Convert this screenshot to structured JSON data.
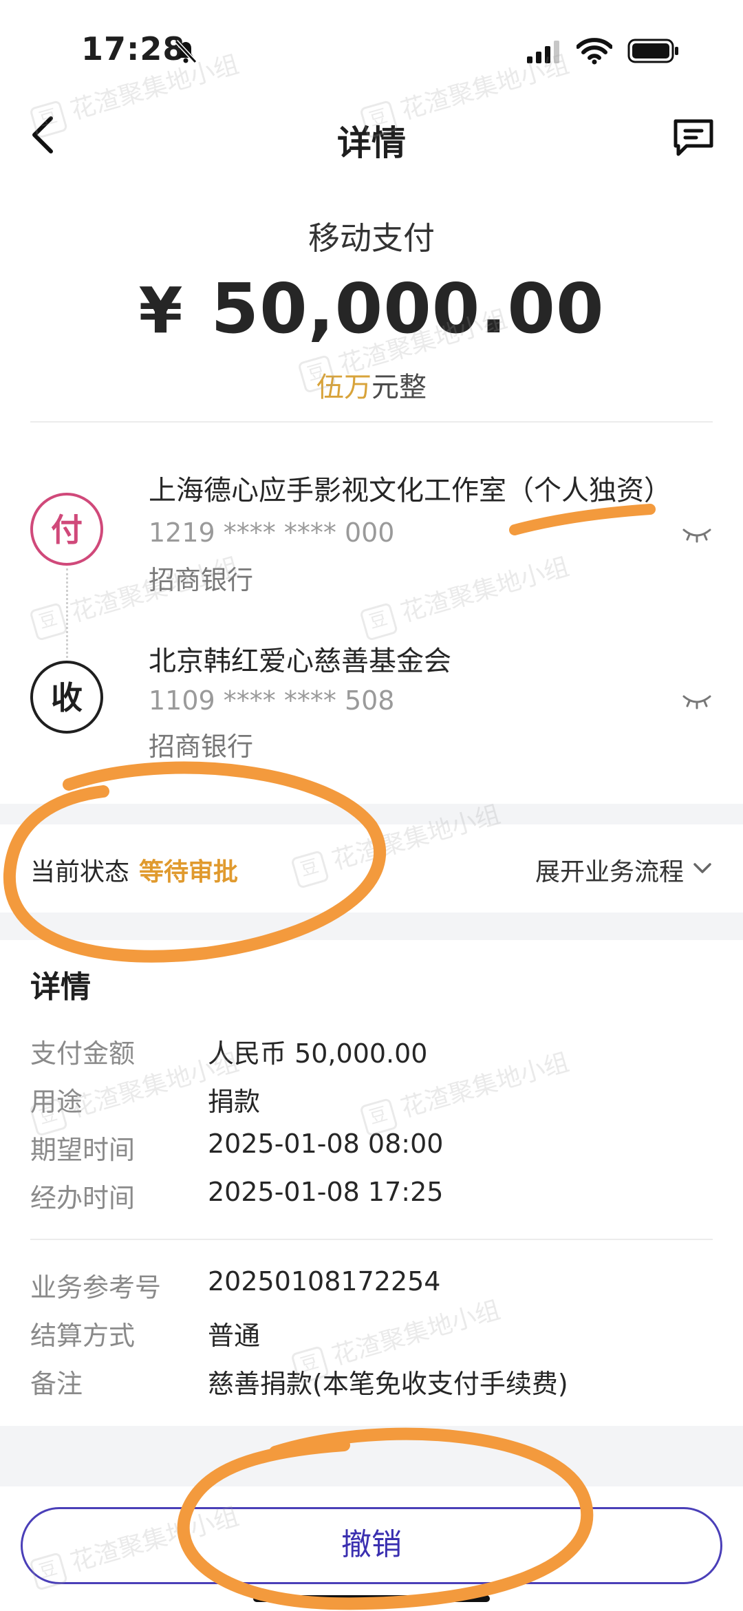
{
  "status_bar": {
    "time": "17:28"
  },
  "header": {
    "title": "详情"
  },
  "payment": {
    "type": "移动支付",
    "currency_symbol": "¥",
    "amount": "50,000.00",
    "amount_words_hl": "伍万",
    "amount_words_rest": "元整"
  },
  "payer": {
    "badge": "付",
    "name": "上海德心应手影视文化工作室（个人独资）",
    "account": "1219 **** **** 000",
    "bank": "招商银行"
  },
  "payee": {
    "badge": "收",
    "name": "北京韩红爱心慈善基金会",
    "account": "1109 **** **** 508",
    "bank": "招商银行"
  },
  "status": {
    "label": "当前状态",
    "value": "等待审批",
    "expand": "展开业务流程"
  },
  "details": {
    "title": "详情",
    "rows": [
      {
        "label": "支付金额",
        "value": "人民币 50,000.00"
      },
      {
        "label": "用途",
        "value": "捐款"
      },
      {
        "label": "期望时间",
        "value": "2025-01-08 08:00"
      },
      {
        "label": "经办时间",
        "value": "2025-01-08 17:25"
      }
    ],
    "rows2": [
      {
        "label": "业务参考号",
        "value": "20250108172254"
      },
      {
        "label": "结算方式",
        "value": "普通"
      },
      {
        "label": "备注",
        "value": "慈善捐款(本笔免收支付手续费)"
      }
    ]
  },
  "actions": {
    "cancel": "撤销"
  },
  "watermark": {
    "icon": "豆",
    "text": "花渣聚集地小组"
  },
  "colors": {
    "accent_pay": "#d0497a",
    "status_pending": "#e09a2e",
    "button_primary": "#3a2fb0",
    "annotation": "#f39a3d"
  }
}
